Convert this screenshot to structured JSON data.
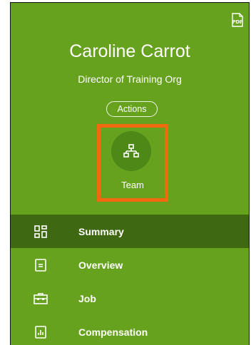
{
  "toolbar": {
    "pdf_label": "PDF"
  },
  "profile": {
    "name": "Caroline Carrot",
    "title": "Director of Training Org",
    "actions_label": "Actions",
    "team_label": "Team"
  },
  "nav": {
    "items": [
      {
        "label": "Summary",
        "icon": "grid-icon",
        "active": true
      },
      {
        "label": "Overview",
        "icon": "document-icon",
        "active": false
      },
      {
        "label": "Job",
        "icon": "briefcase-icon",
        "active": false
      },
      {
        "label": "Compensation",
        "icon": "bar-chart-icon",
        "active": false
      }
    ]
  },
  "colors": {
    "card_bg": "#67a21f",
    "active_bg": "#3e6912",
    "team_circle": "#4e8816",
    "highlight": "#f26a10"
  }
}
